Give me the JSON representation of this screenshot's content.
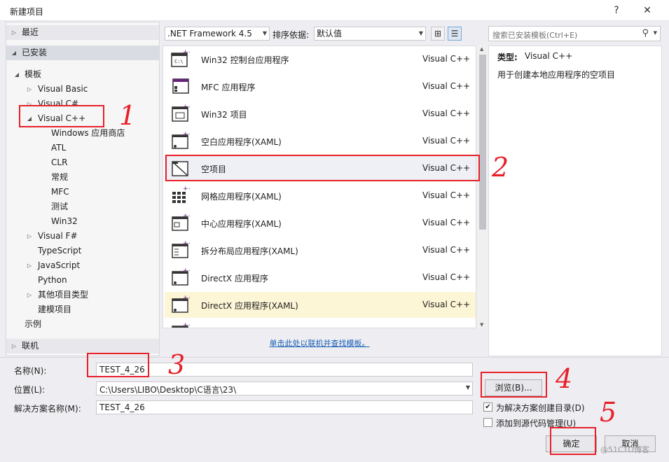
{
  "dialog": {
    "title": "新建项目",
    "help_glyph": "?",
    "close_glyph": "✕"
  },
  "tree": {
    "recent": "最近",
    "installed": "已安装",
    "templates": "模板",
    "visual_basic": "Visual Basic",
    "visual_csharp": "Visual C#",
    "visual_cpp": "Visual C++",
    "cpp_children": [
      "Windows 应用商店",
      "ATL",
      "CLR",
      "常规",
      "MFC",
      "测试",
      "Win32"
    ],
    "visual_fsharp": "Visual F#",
    "typescript": "TypeScript",
    "javascript": "JavaScript",
    "python": "Python",
    "other_types": "其他项目类型",
    "modeling": "建模项目",
    "samples": "示例",
    "online": "联机"
  },
  "toolbar": {
    "framework": ".NET Framework 4.5",
    "sort_label": "排序依据:",
    "sort_value": "默认值"
  },
  "search": {
    "placeholder": "搜索已安装模板(Ctrl+E)"
  },
  "templates": [
    {
      "name": "Win32 控制台应用程序",
      "lang": "Visual C++"
    },
    {
      "name": "MFC 应用程序",
      "lang": "Visual C++"
    },
    {
      "name": "Win32 项目",
      "lang": "Visual C++"
    },
    {
      "name": "空白应用程序(XAML)",
      "lang": "Visual C++"
    },
    {
      "name": "空项目",
      "lang": "Visual C++"
    },
    {
      "name": "网格应用程序(XAML)",
      "lang": "Visual C++"
    },
    {
      "name": "中心应用程序(XAML)",
      "lang": "Visual C++"
    },
    {
      "name": "拆分布局应用程序(XAML)",
      "lang": "Visual C++"
    },
    {
      "name": "DirectX 应用程序",
      "lang": "Visual C++"
    },
    {
      "name": "DirectX 应用程序(XAML)",
      "lang": "Visual C++"
    }
  ],
  "online_link": "单击此处以联机并查找模板。",
  "description": {
    "type_label": "类型:",
    "type_value": "Visual C++",
    "text": "用于创建本地应用程序的空项目"
  },
  "form": {
    "name_label": "名称(N):",
    "name_value": "TEST_4_26",
    "location_label": "位置(L):",
    "location_value": "C:\\Users\\LIBO\\Desktop\\C语言\\23\\",
    "solution_label": "解决方案名称(M):",
    "solution_value": "TEST_4_26",
    "browse": "浏览(B)...",
    "create_dir": "为解决方案创建目录(D)",
    "add_source": "添加到源代码管理(U)",
    "ok": "确定",
    "cancel": "取消"
  },
  "annotations": [
    "1",
    "2",
    "3",
    "4",
    "5"
  ],
  "watermark": "@51CTO博客",
  "colors": {
    "annotation": "#e8202a",
    "link": "#1a5fb4",
    "selection": "#d9dde3"
  }
}
